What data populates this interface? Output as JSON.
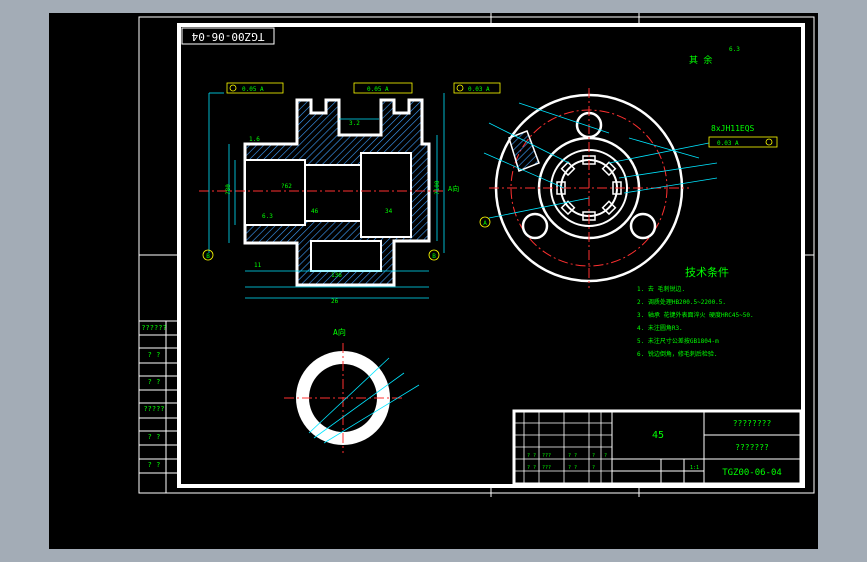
{
  "drawing": {
    "code_stamp": "TGZ00-06-04",
    "surface_note": "其 余",
    "section_label": "A向",
    "view_label": "A向",
    "datum_letter": "A",
    "datum_b": "B",
    "spline_spec": "8xJH11EQS",
    "tech_title": "技术条件",
    "tech_notes": [
      "1. 去 毛刺锐边.",
      "2. 调质处理HB200.5~2200.5.",
      "3. 轴承 花键外表面淬火 硬度HRC45~50.",
      "4. 未注圆角R3.",
      "5. 未注尺寸公差按GB1804-m",
      "6. 锐边倒角，修毛刺后检验."
    ],
    "left_cells": [
      "??????",
      "? ?",
      "? ?",
      "?????",
      "? ?",
      "? ?"
    ],
    "title_block": {
      "name": "????????",
      "material": "45",
      "company": "???????",
      "number": "TGZ00-06-04",
      "scale": "1:1",
      "grid_header": [
        "? ?",
        "???",
        "? ?",
        "?",
        "?"
      ],
      "grid_row2": [
        "? ?",
        "???",
        "? ?",
        "?"
      ]
    },
    "dims": {
      "overall_length": "136",
      "height_left": "?80",
      "height_right": "?100",
      "bore": "?62",
      "roughness_a": "1.6",
      "roughness_b": "3.2",
      "roughness_c": "6.3",
      "fcf_1": "0.05 A",
      "fcf_2": "0.05 A",
      "fcf_3": "0.03 A",
      "fcf_spline": "0.03 A",
      "len_small": "11",
      "len_mid": "26",
      "len_left": "46",
      "len_right": "34"
    }
  }
}
